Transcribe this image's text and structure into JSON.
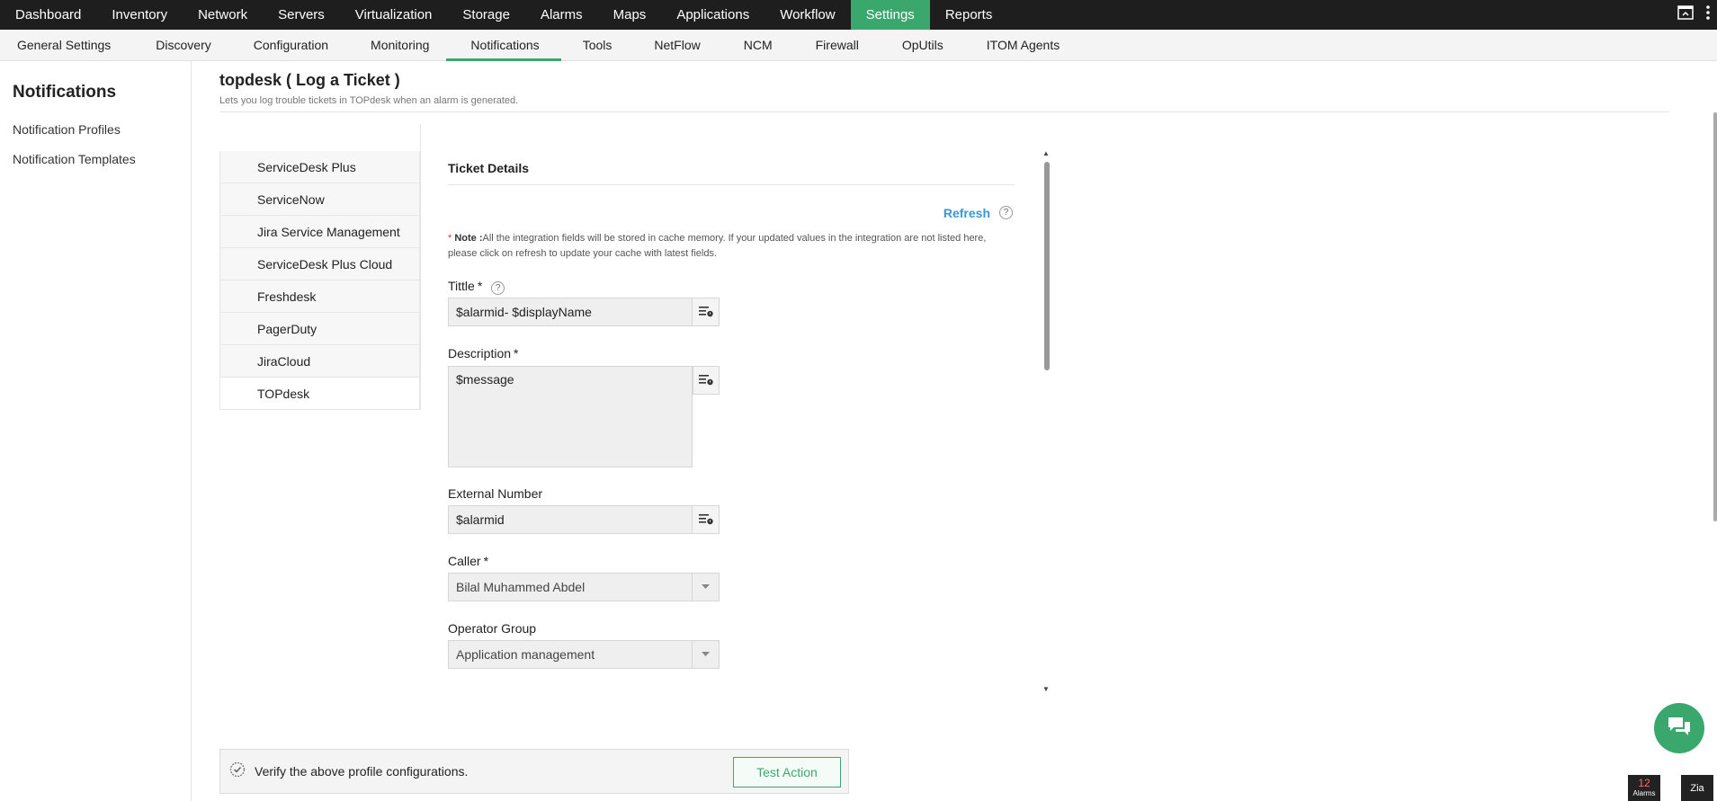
{
  "topnav": {
    "items": [
      "Dashboard",
      "Inventory",
      "Network",
      "Servers",
      "Virtualization",
      "Storage",
      "Alarms",
      "Maps",
      "Applications",
      "Workflow",
      "Settings",
      "Reports"
    ],
    "active": "Settings",
    "accent": "#3aa76d"
  },
  "subnav": {
    "items": [
      "General Settings",
      "Discovery",
      "Configuration",
      "Monitoring",
      "Notifications",
      "Tools",
      "NetFlow",
      "NCM",
      "Firewall",
      "OpUtils",
      "ITOM Agents"
    ],
    "active": "Notifications"
  },
  "sidebar": {
    "title": "Notifications",
    "links": [
      "Notification Profiles",
      "Notification Templates"
    ]
  },
  "page": {
    "title": "topdesk ( Log a Ticket )",
    "subtitle": "Lets you log trouble tickets in TOPdesk when an alarm is generated."
  },
  "integrations": [
    "ServiceDesk Plus",
    "ServiceNow",
    "Jira Service Management",
    "ServiceDesk Plus Cloud",
    "Freshdesk",
    "PagerDuty",
    "JiraCloud",
    "TOPdesk"
  ],
  "integrations_active": "TOPdesk",
  "ticket": {
    "heading": "Ticket Details",
    "refresh": "Refresh",
    "note_star": "*",
    "note_label": "Note :",
    "note_text": "All the integration fields will be stored in cache memory. If your updated values in the integration are not listed here, please click on refresh to update your cache with latest fields.",
    "title_label": "Tittle",
    "title_value": "$alarmid- $displayName",
    "description_label": "Description",
    "description_value": "$message",
    "external_label": "External Number",
    "external_value": "$alarmid",
    "caller_label": "Caller",
    "caller_value": "Bilal Muhammed Abdel",
    "operator_label": "Operator Group",
    "operator_value": "Application management",
    "required_mark": "*",
    "help_mark": "?"
  },
  "verify": {
    "text": "Verify the above profile configurations.",
    "button": "Test Action"
  },
  "alarms_badge": {
    "count": "12",
    "label": "Alarms"
  },
  "zia": "Zia"
}
